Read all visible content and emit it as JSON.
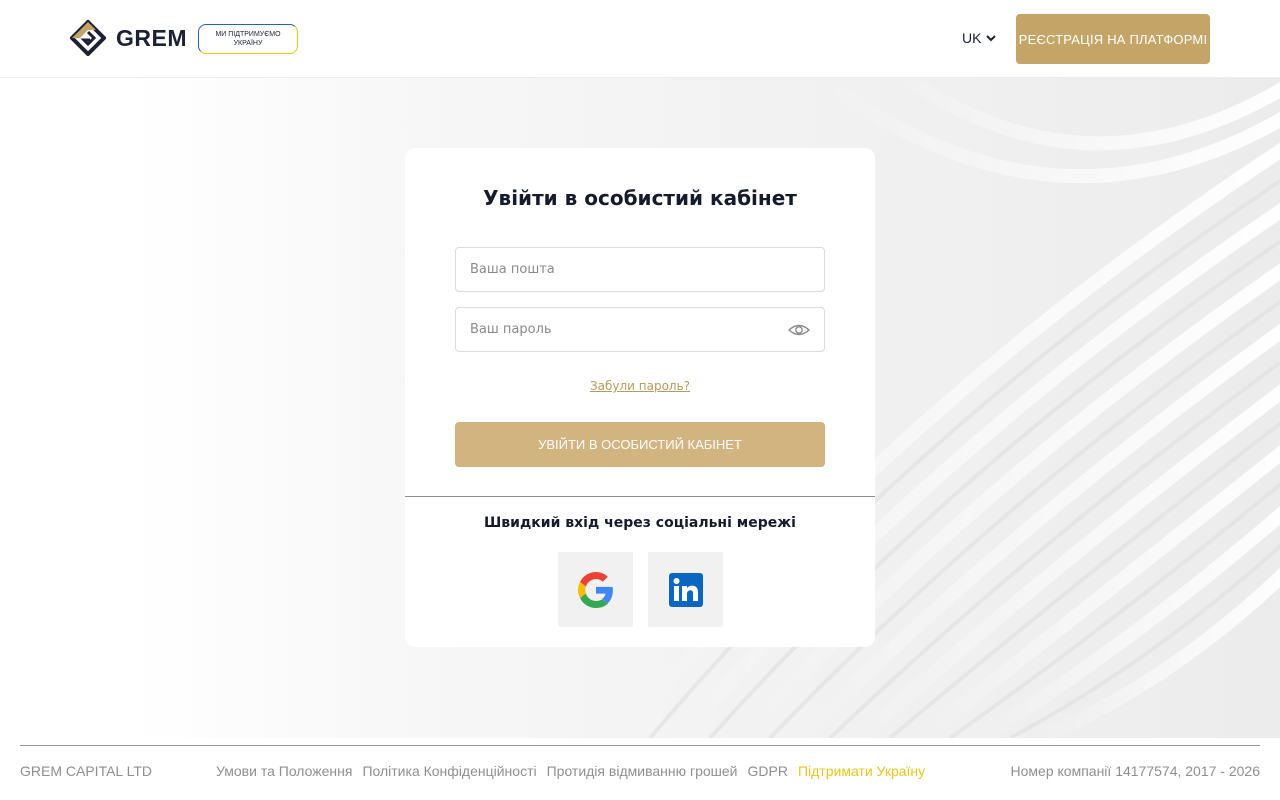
{
  "header": {
    "logo_text": "GREM",
    "badge_line1": "МИ ПІДТРИМУЄМО",
    "badge_line2": "УКРАЇНУ",
    "language": "UK",
    "register_label": "РЕЄСТРАЦІЯ НА ПЛАТФОРМІ"
  },
  "login": {
    "title": "Увійти в особистий кабінет",
    "email_placeholder": "Ваша пошта",
    "password_placeholder": "Ваш пароль",
    "forgot_label": "Забули пароль?",
    "submit_label": "УВІЙТИ В ОСОБИСТИЙ КАБІНЕТ",
    "social_title": "Швидкий вхід через соціальні мережі",
    "social": [
      {
        "name": "google",
        "icon": "google-icon"
      },
      {
        "name": "linkedin",
        "icon": "linkedin-icon"
      }
    ]
  },
  "footer": {
    "company": "GREM CAPITAL LTD",
    "links": [
      "Умови та Положення",
      "Політика Конфіденційності",
      "Протидія відмиванню грошей",
      "GDPR"
    ],
    "support_link": "Підтримати Україну",
    "registration": "Номер компанії 14177574, 2017 - 2026"
  },
  "colors": {
    "accent": "#c4a567",
    "button": "#d1b47f",
    "support": "#e8c51b",
    "text_dark": "#161a2d"
  }
}
